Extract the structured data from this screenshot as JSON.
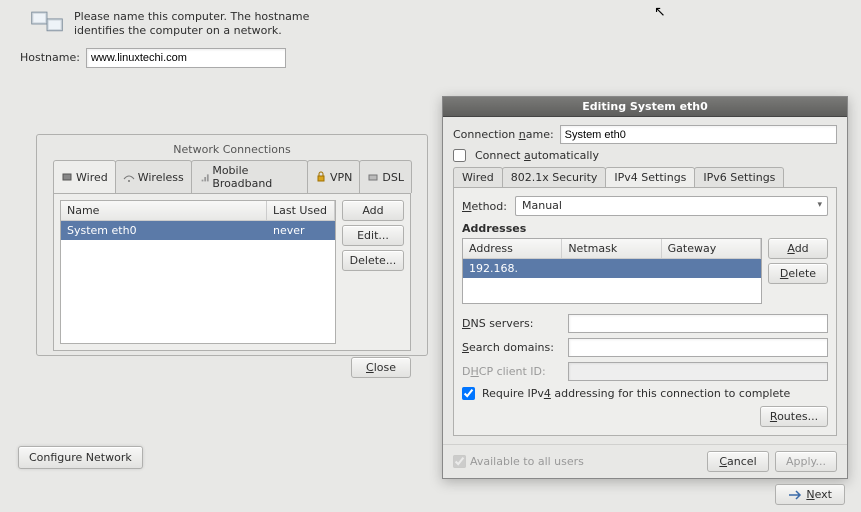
{
  "header": {
    "text": "Please name this computer. The hostname identifies the computer on a network."
  },
  "hostname": {
    "label": "Hostname:",
    "value": "www.linuxtechi.com"
  },
  "netPanel": {
    "title": "Network Connections",
    "tabs": {
      "wired": "Wired",
      "wireless": "Wireless",
      "mobile": "Mobile Broadband",
      "vpn": "VPN",
      "dsl": "DSL"
    },
    "cols": {
      "name": "Name",
      "last": "Last Used"
    },
    "row": {
      "name": "System eth0",
      "last": "never"
    },
    "buttons": {
      "add": "Add",
      "edit": "Edit...",
      "del": "Delete...",
      "close": "Close"
    }
  },
  "dlg": {
    "title": "Editing System eth0",
    "connName": {
      "label": "Connection name:",
      "value": "System eth0"
    },
    "connectAuto": "Connect automatically",
    "tabs": {
      "wired": "Wired",
      "sec": "802.1x Security",
      "ipv4": "IPv4 Settings",
      "ipv6": "IPv6 Settings"
    },
    "method": {
      "label": "Method:",
      "value": "Manual"
    },
    "addresses": {
      "title": "Addresses",
      "cols": {
        "addr": "Address",
        "mask": "Netmask",
        "gw": "Gateway"
      },
      "row": {
        "addr": "192.168.",
        "mask": "",
        "gw": ""
      },
      "add": "Add",
      "del": "Delete"
    },
    "dns": {
      "label": "DNS servers:",
      "value": ""
    },
    "search": {
      "label": "Search domains:",
      "value": ""
    },
    "dhcp": {
      "label": "DHCP client ID:",
      "value": ""
    },
    "require": "Require IPv4 addressing for this connection to complete",
    "routes": "Routes...",
    "avail": "Available to all users",
    "cancel": "Cancel",
    "apply": "Apply..."
  },
  "configNet": "Configure Network",
  "next": "Next"
}
